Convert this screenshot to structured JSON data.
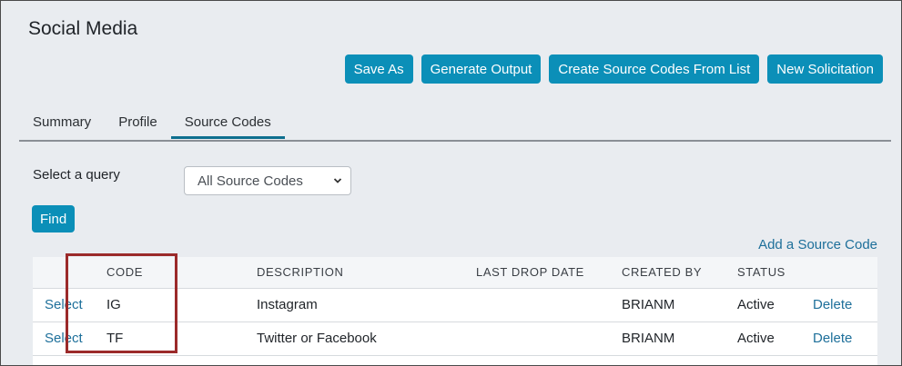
{
  "page": {
    "title": "Social Media"
  },
  "actions": {
    "save_as": "Save As",
    "generate_output": "Generate Output",
    "create_from_list": "Create Source Codes From List",
    "new_solicitation": "New Solicitation"
  },
  "tabs": [
    {
      "label": "Summary"
    },
    {
      "label": "Profile"
    },
    {
      "label": "Source Codes"
    }
  ],
  "query": {
    "label": "Select a query",
    "selected": "All Source Codes",
    "find_label": "Find"
  },
  "add_source_code": "Add a Source Code",
  "table": {
    "headers": [
      "",
      "CODE",
      "DESCRIPTION",
      "LAST DROP DATE",
      "CREATED BY",
      "STATUS",
      ""
    ],
    "rows": [
      {
        "select": "Select",
        "code": "IG",
        "description": "Instagram",
        "last_drop_date": "",
        "created_by": "BRIANM",
        "status": "Active",
        "delete": "Delete"
      },
      {
        "select": "Select",
        "code": "TF",
        "description": "Twitter or Facebook",
        "last_drop_date": "",
        "created_by": "BRIANM",
        "status": "Active",
        "delete": "Delete"
      }
    ]
  },
  "colors": {
    "accent": "#0b8fb8",
    "link": "#1d6f9a",
    "highlight": "#9b2a2a",
    "background": "#e9ecf0"
  }
}
